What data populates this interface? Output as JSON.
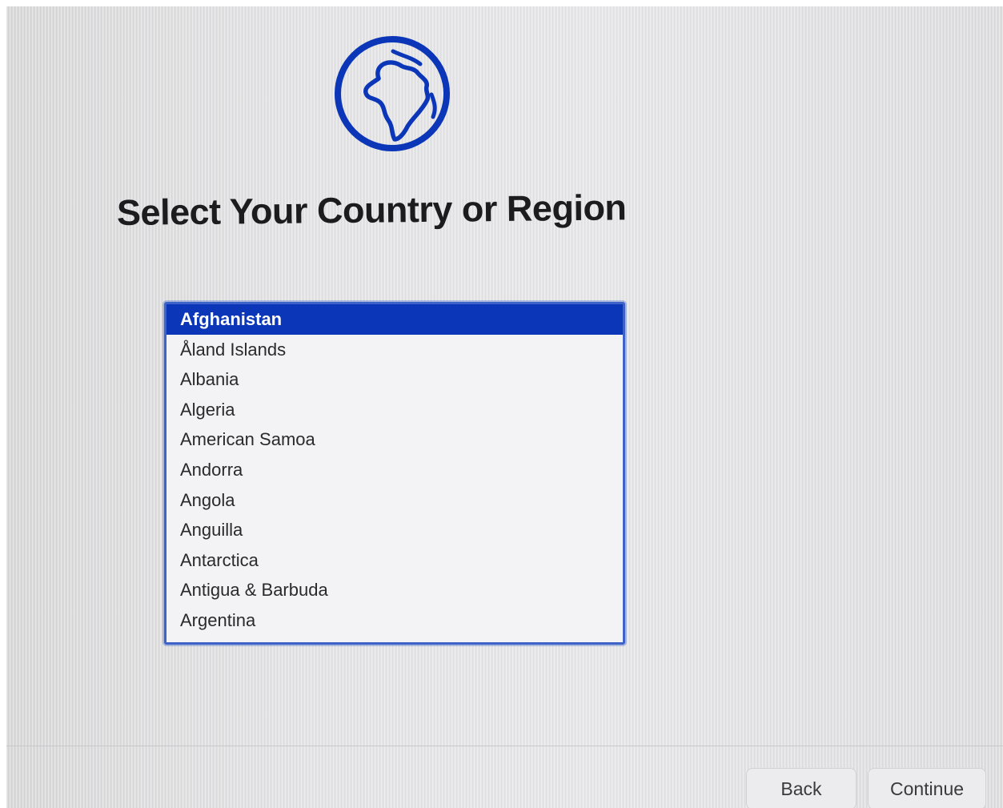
{
  "header": {
    "icon": "globe-africa-icon",
    "title": "Select Your Country or Region"
  },
  "country_list": {
    "selected": "Afghanistan",
    "items": [
      "Afghanistan",
      "Åland Islands",
      "Albania",
      "Algeria",
      "American Samoa",
      "Andorra",
      "Angola",
      "Anguilla",
      "Antarctica",
      "Antigua & Barbuda",
      "Argentina"
    ]
  },
  "footer": {
    "back_label": "Back",
    "continue_label": "Continue"
  },
  "colors": {
    "accent": "#0b36b8",
    "selection_text": "#ffffff",
    "focus_ring": "#3d63c9"
  }
}
